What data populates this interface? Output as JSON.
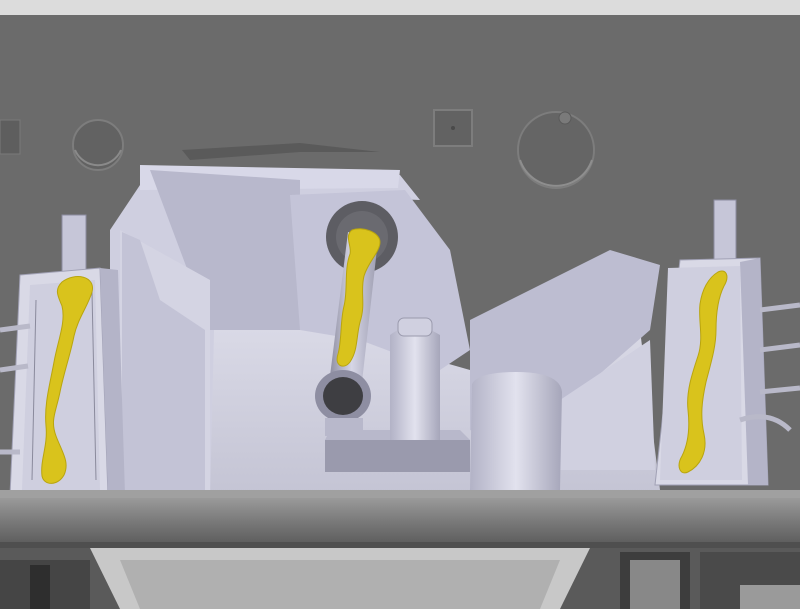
{
  "scene": {
    "kind": "cad-3d-render",
    "colors": {
      "top_strip": "#dcdcdc",
      "background_wall": "#6b6b6b",
      "machine_body": "#c9c9dc",
      "machine_shadow": "#9c9cb0",
      "highlight_weld": "#d9c31c",
      "frame_beam": "#7d7d7d",
      "frame_dark": "#4a4a4a"
    },
    "highlighted_regions": 3
  }
}
